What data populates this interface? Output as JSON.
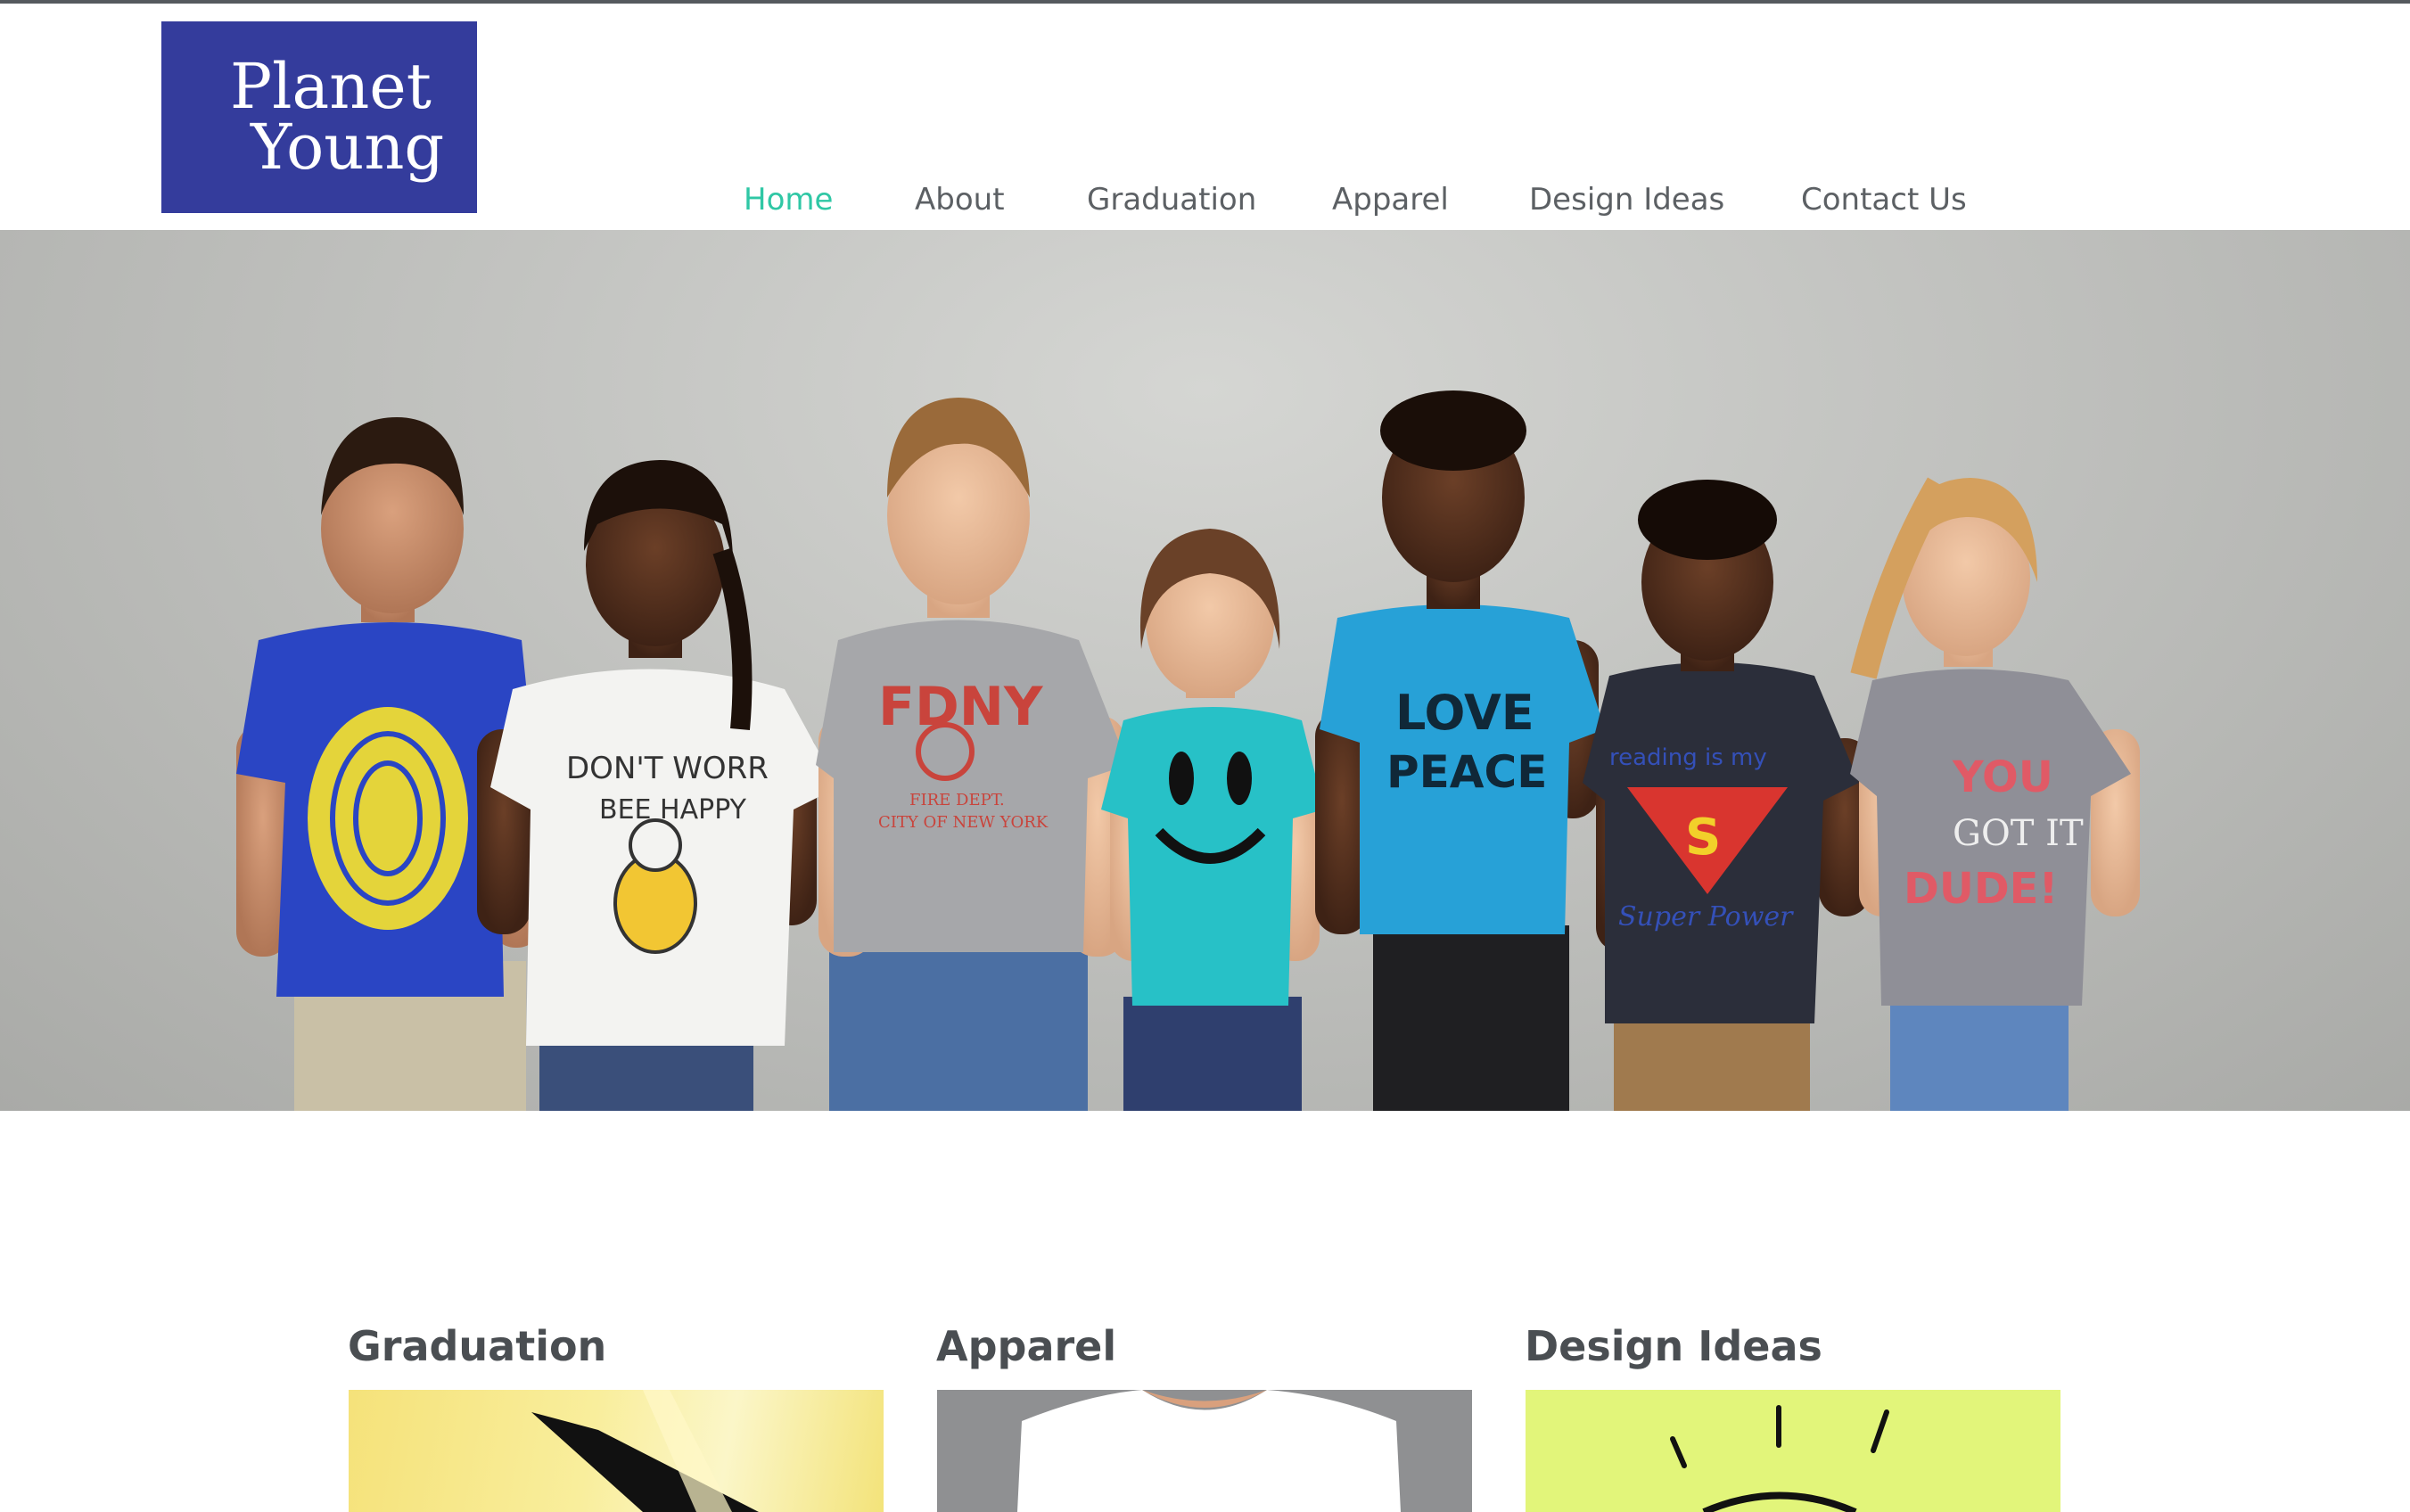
{
  "logo": {
    "line1": "Planet",
    "line2": "Young"
  },
  "nav": {
    "items": [
      {
        "label": "Home",
        "active": true
      },
      {
        "label": "About",
        "active": false
      },
      {
        "label": "Graduation",
        "active": false
      },
      {
        "label": "Apparel",
        "active": false
      },
      {
        "label": "Design Ideas",
        "active": false
      },
      {
        "label": "Contact Us",
        "active": false
      }
    ]
  },
  "hero": {
    "shirt_prints": {
      "shirt2_line1": "DON'T WORR",
      "shirt2_line2": "BEE HAPPY",
      "shirt3_title": "FDNY",
      "shirt3_line1": "FIRE DEPT.",
      "shirt3_line2": "CITY OF NEW YORK",
      "shirt5_line1": "LOVE",
      "shirt5_line2": "PEACE",
      "shirt6_line1": "reading is my",
      "shirt6_letter": "S",
      "shirt6_line2": "Super Power",
      "shirt7_line1": "YOU",
      "shirt7_line2": "GOT IT",
      "shirt7_line3": "DUDE!"
    }
  },
  "cards": [
    {
      "title": "Graduation"
    },
    {
      "title": "Apparel"
    },
    {
      "title": "Design Ideas"
    }
  ],
  "colors": {
    "accent": "#2fc7a5",
    "logo_bg": "#343c9c",
    "nav_text": "#5c6064"
  }
}
